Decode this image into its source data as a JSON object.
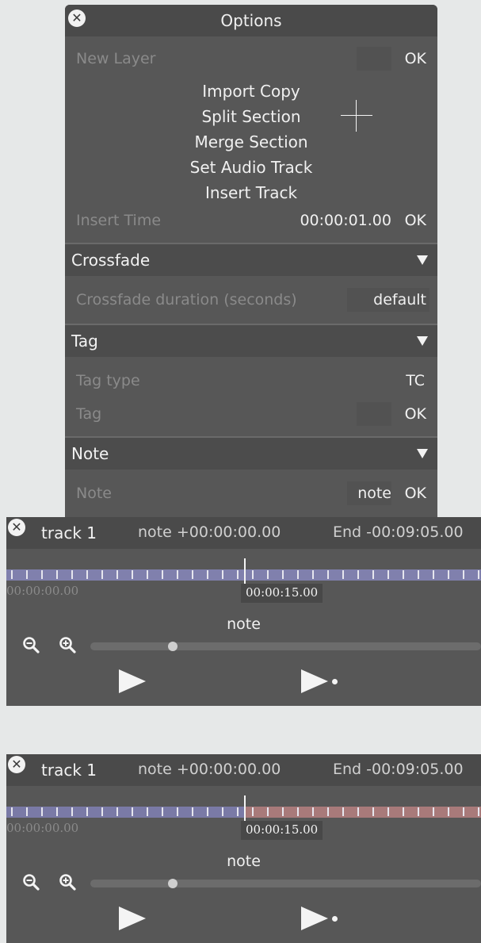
{
  "options": {
    "title": "Options",
    "new_layer_label": "New Layer",
    "new_layer_ok": "OK",
    "menu": [
      "Import Copy",
      "Split Section",
      "Merge Section",
      "Set Audio Track",
      "Insert Track"
    ],
    "insert_time_label": "Insert Time",
    "insert_time_value": "00:00:01.00",
    "insert_time_ok": "OK",
    "crossfade": {
      "heading": "Crossfade",
      "duration_label": "Crossfade duration (seconds)",
      "duration_value": "default"
    },
    "tag": {
      "heading": "Tag",
      "type_label": "Tag type",
      "type_value": "TC",
      "tag_label": "Tag",
      "tag_ok": "OK"
    },
    "note": {
      "heading": "Note",
      "note_label": "Note",
      "note_value": "note",
      "note_ok": "OK"
    }
  },
  "tracks": [
    {
      "name": "track 1",
      "note_offset": "note +00:00:00.00",
      "end": "End -00:09:05.00",
      "start_time": "00:00:00.00",
      "playhead_time": "00:00:15.00",
      "label": "note",
      "colors": {
        "left": "#8080ad",
        "right": "#8080ad"
      }
    },
    {
      "name": "track 1",
      "note_offset": "note +00:00:00.00",
      "end": "End -00:09:05.00",
      "start_time": "00:00:00.00",
      "playhead_time": "00:00:15.00",
      "label": "note",
      "colors": {
        "left": "#7a7aa6",
        "right": "#a87a7a"
      }
    }
  ],
  "icons": {
    "close": "close-icon",
    "zoom_out": "zoom-out-icon",
    "zoom_in": "zoom-in-icon",
    "play": "play-icon",
    "play_note": "play-note-icon",
    "collapse": "triangle-down-icon"
  }
}
